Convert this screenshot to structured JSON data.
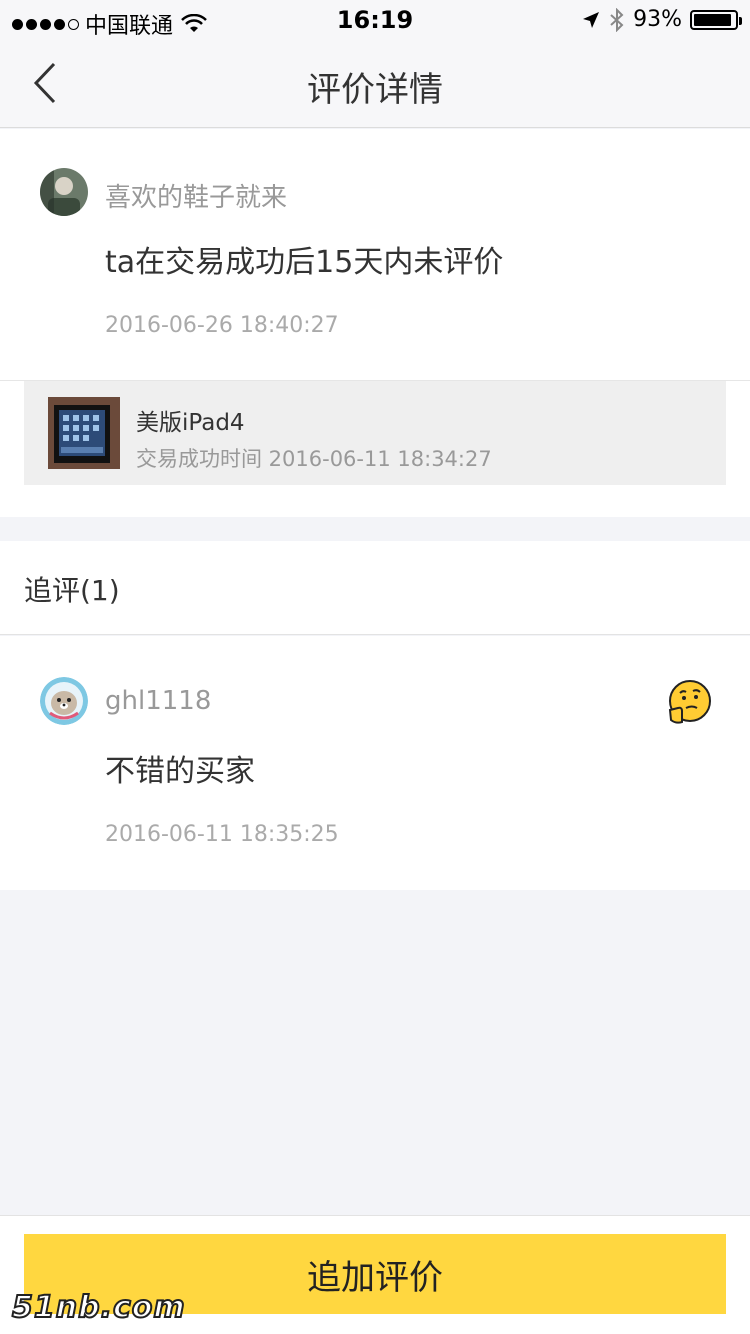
{
  "status_bar": {
    "carrier": "中国联通",
    "time": "16:19",
    "battery_percent": "93%",
    "battery_level": 0.93
  },
  "nav": {
    "title": "评价详情"
  },
  "review": {
    "username": "喜欢的鞋子就来",
    "text": "ta在交易成功后15天内未评价",
    "date": "2016-06-26 18:40:27"
  },
  "product": {
    "name": "美版iPad4",
    "trade_time": "交易成功时间 2016-06-11 18:34:27"
  },
  "followup": {
    "title": "追评(1)",
    "username": "ghl1118",
    "text": "不错的买家",
    "date": "2016-06-11 18:35:25",
    "emoji": "thinking-face-icon"
  },
  "bottom": {
    "button_label": "追加评价"
  },
  "watermark": "51nb.com",
  "colors": {
    "accent": "#ffd740",
    "background": "#f3f4f8"
  }
}
